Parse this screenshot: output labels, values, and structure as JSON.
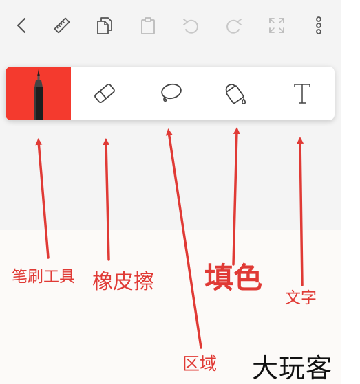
{
  "topbar": {
    "items": [
      {
        "icon": "back-chevron-icon",
        "enabled": true
      },
      {
        "icon": "ruler-icon",
        "enabled": true
      },
      {
        "icon": "copy-icon",
        "enabled": true
      },
      {
        "icon": "paste-icon",
        "enabled": false
      },
      {
        "icon": "undo-icon",
        "enabled": false
      },
      {
        "icon": "redo-icon",
        "enabled": false
      },
      {
        "icon": "fullscreen-icon",
        "enabled": false
      },
      {
        "icon": "more-vertical-icon",
        "enabled": true
      }
    ]
  },
  "palette": {
    "active_tool": "brush",
    "active_color": "#f43a2e",
    "tools": [
      {
        "id": "brush",
        "icon": "pen-brush-icon"
      },
      {
        "id": "eraser",
        "icon": "eraser-icon"
      },
      {
        "id": "lasso",
        "icon": "lasso-icon"
      },
      {
        "id": "fill",
        "icon": "paint-bucket-icon"
      },
      {
        "id": "text",
        "icon": "text-t-icon"
      }
    ]
  },
  "annotations": {
    "color": "#e03a35",
    "brush": "笔刷工具",
    "eraser": "橡皮擦",
    "lasso": "区域",
    "fill": "填色",
    "text": "文字"
  },
  "watermark": {
    "text": "大玩客"
  }
}
